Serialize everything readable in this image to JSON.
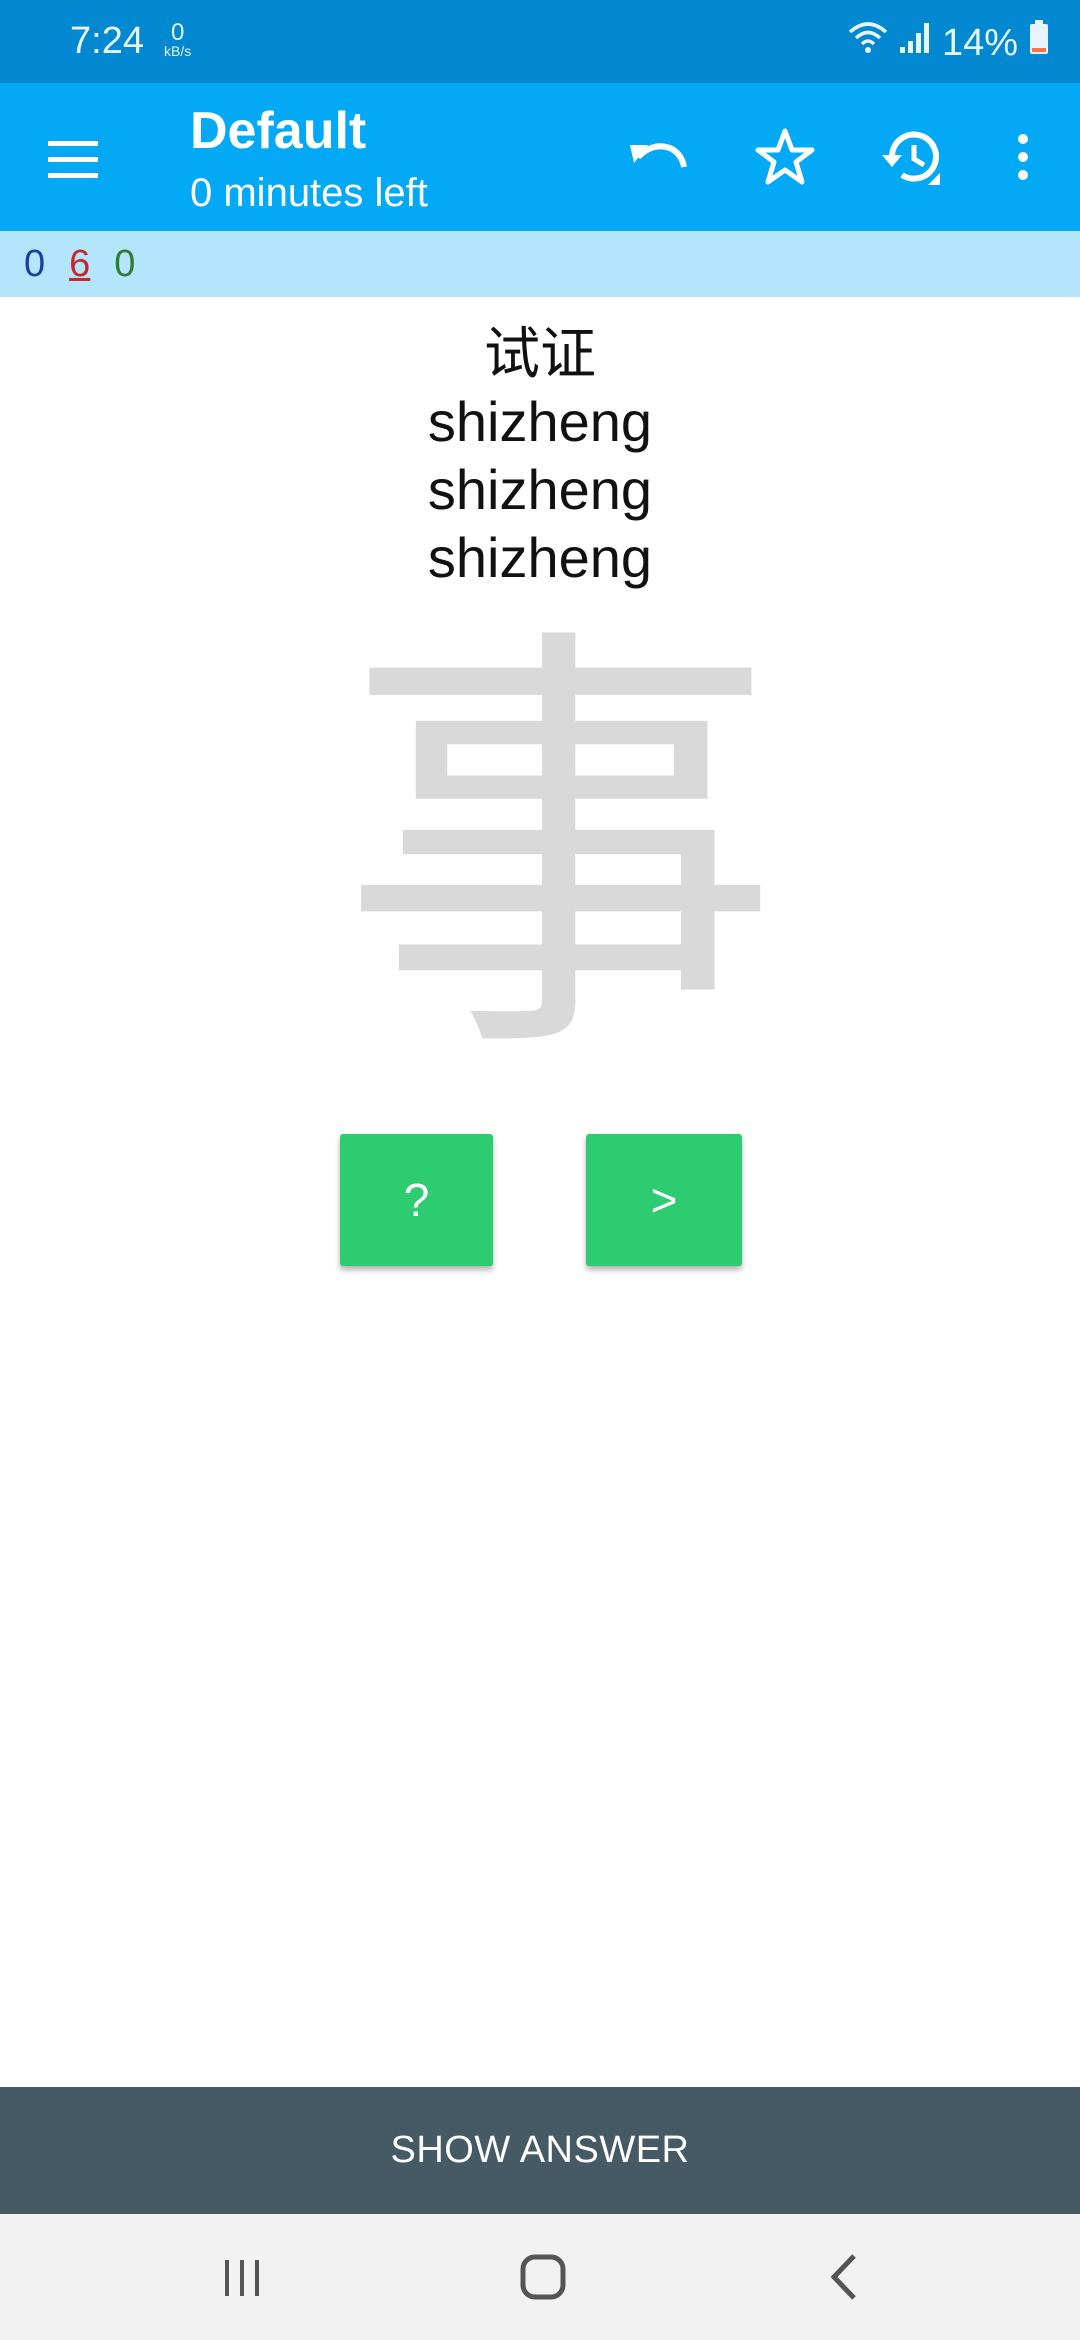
{
  "status_bar": {
    "time": "7:24",
    "net_speed_value": "0",
    "net_speed_unit": "kB/s",
    "battery_percent": "14%",
    "icons": [
      "wifi-icon",
      "signal-icon",
      "battery-icon"
    ]
  },
  "app_bar": {
    "title": "Default",
    "subtitle": "0 minutes left",
    "icons": [
      "menu-icon",
      "undo-icon",
      "star-icon",
      "history-icon",
      "more-vert-icon"
    ]
  },
  "counts": {
    "new": "0",
    "learning": "6",
    "review": "0",
    "colors": {
      "new": "#1e3fa0",
      "learning": "#c62828",
      "review": "#2e7d32"
    }
  },
  "card": {
    "word": "试证",
    "line1": "shizheng",
    "line2": "shizheng",
    "line3": "shizheng",
    "stroke_character": "事"
  },
  "buttons": {
    "hint_label": "?",
    "next_label": ">",
    "show_answer_label": "SHOW ANSWER"
  },
  "colors": {
    "status_bar": "#0288d1",
    "app_bar": "#03a9f4",
    "counts_bar": "#b3e5fc",
    "action_button": "#2ecc71",
    "show_answer_bar": "#455a64"
  },
  "nav_bar": {
    "icons": [
      "recent-apps-icon",
      "home-icon",
      "back-icon"
    ]
  }
}
